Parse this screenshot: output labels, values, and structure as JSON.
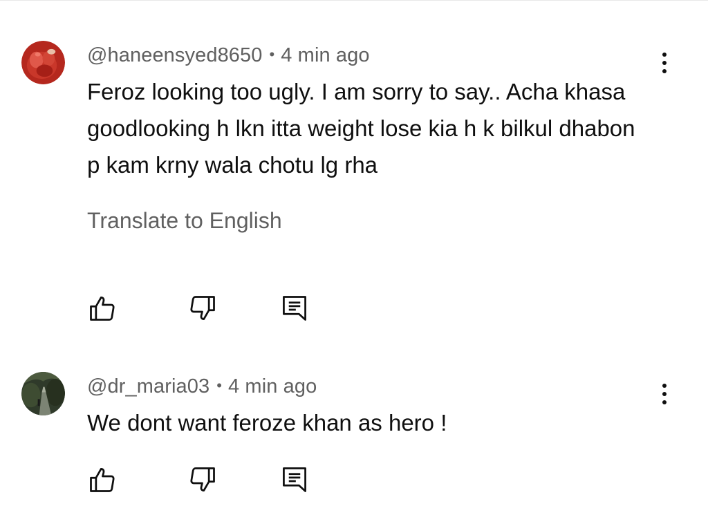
{
  "comments": [
    {
      "author": "@haneensyed8650",
      "separator": "•",
      "time": "4 min ago",
      "text": "Feroz looking too ugly. I am sorry to say.. Acha khasa goodlooking h lkn itta weight lose kia h k bilkul dhabon p kam krny wala chotu lg rha",
      "translate_label": "Translate to English",
      "avatar_icon": "red-flower-avatar-icon"
    },
    {
      "author": "@dr_maria03",
      "separator": "•",
      "time": "4 min ago",
      "text": "We dont want feroze khan as hero !",
      "avatar_icon": "road-scene-avatar-icon"
    }
  ],
  "icons": {
    "like": "thumbs-up-icon",
    "dislike": "thumbs-down-icon",
    "reply": "reply-comment-icon",
    "more": "more-vertical-icon"
  },
  "colors": {
    "primary_text": "#0f0f0f",
    "secondary_text": "#606060",
    "background": "#ffffff"
  }
}
